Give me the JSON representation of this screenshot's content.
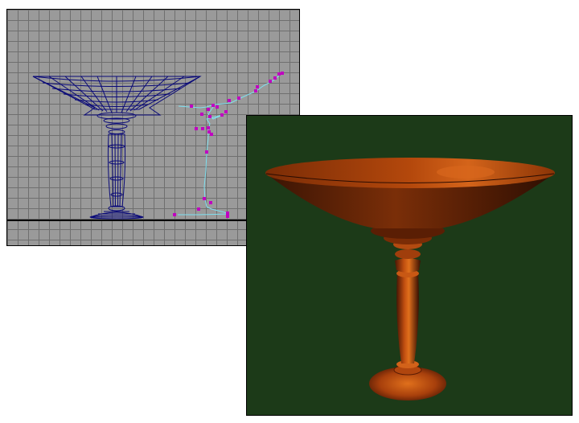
{
  "scene": {
    "ortho_viewport": {
      "grid_color": "#6f6f6f",
      "background_color": "#9a9a9a",
      "wireframe_color": "#0a0a78",
      "profile_curve_color": "#7fe0f0",
      "control_vertex_color": "#c000c0",
      "ground_line_color": "#000000"
    },
    "render_viewport": {
      "background_color": "#1c3a18",
      "object_color": "#b04a10",
      "highlight_color": "#e0701c"
    }
  }
}
